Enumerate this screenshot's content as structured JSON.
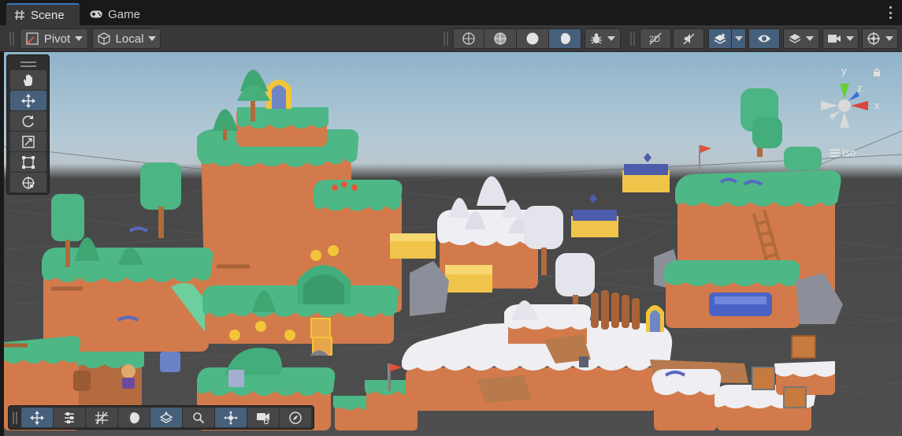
{
  "tabs": [
    {
      "label": "Scene",
      "icon": "hash-grid-icon",
      "active": true
    },
    {
      "label": "Game",
      "icon": "gamepad-icon",
      "active": false
    }
  ],
  "toolbar": {
    "pivot_label": "Pivot",
    "local_label": "Local",
    "draw_modes": [
      "wireframe-icon",
      "shaded-wireframe-icon",
      "shaded-icon",
      "unlit-icon"
    ],
    "selected_draw_mode": "unlit-icon",
    "right_buttons": [
      "debug-bug-icon",
      "2d-toggle-icon",
      "audio-mute-icon",
      "effects-layers-icon",
      "visibility-eye-icon",
      "layers-icon",
      "camera-icon",
      "gizmos-icon"
    ]
  },
  "tools": {
    "items": [
      "hand-icon",
      "move-icon",
      "rotate-icon",
      "scale-icon",
      "rect-icon",
      "transform-icon"
    ],
    "selected": "move-icon"
  },
  "overlay_bottom": {
    "items": [
      "move-icon",
      "snap-settings-icon",
      "grid-snap-icon",
      "lighting-icon",
      "layer-icon",
      "search-icon",
      "pivot-icon",
      "camera-record-icon",
      "navigation-icon"
    ]
  },
  "gizmo": {
    "axis_y": "y",
    "axis_z": "z",
    "axis_x": "x",
    "projection_label": "Iso"
  },
  "colors": {
    "accent": "#3a79bb",
    "selected_button": "#46607c",
    "grass": "#4db886",
    "dirt": "#d98657",
    "snow": "#e9e9ee"
  }
}
